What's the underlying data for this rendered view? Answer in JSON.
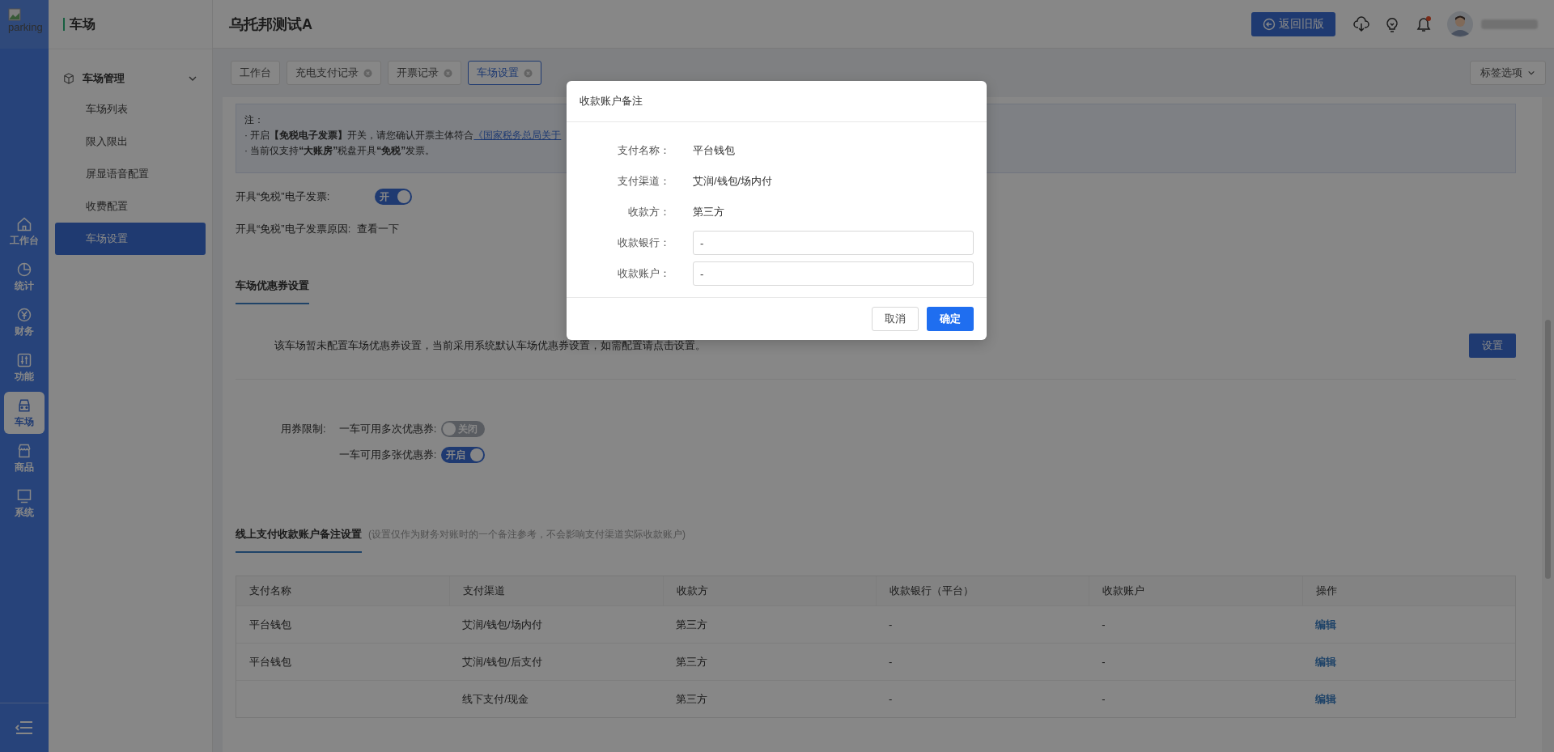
{
  "logo": {
    "alt_text": "parking"
  },
  "rail": [
    {
      "label": "工作台",
      "selected": false
    },
    {
      "label": "统计",
      "selected": false
    },
    {
      "label": "财务",
      "selected": false
    },
    {
      "label": "功能",
      "selected": false
    },
    {
      "label": "车场",
      "selected": true
    },
    {
      "label": "商品",
      "selected": false
    },
    {
      "label": "系统",
      "selected": false
    }
  ],
  "sidebar": {
    "title": "车场",
    "group": {
      "label": "车场管理",
      "expanded": true,
      "items": [
        {
          "label": "车场列表",
          "selected": false
        },
        {
          "label": "限入限出",
          "selected": false
        },
        {
          "label": "屏显语音配置",
          "selected": false
        },
        {
          "label": "收费配置",
          "selected": false
        },
        {
          "label": "车场设置",
          "selected": true
        }
      ]
    }
  },
  "header": {
    "title": "乌托邦测试A",
    "back_button": "返回旧版",
    "notification_dot": true
  },
  "tabs": [
    {
      "label": "工作台",
      "selected": false,
      "closable": false
    },
    {
      "label": "充电支付记录",
      "selected": false,
      "closable": true
    },
    {
      "label": "开票记录",
      "selected": false,
      "closable": true
    },
    {
      "label": "车场设置",
      "selected": true,
      "closable": true
    }
  ],
  "tab_options": "标签选项",
  "note": {
    "heading": "注：",
    "line_1": "· 开启**【免税电子发票】**开关，请您确认开票主体符合",
    "line_1_link": "《国家税务总局关于",
    "line_2": "· 当前仅支持**“大账房”**税盘开具**“免税”**发票。"
  },
  "invoice": {
    "toggle_label": "开具“免税”电子发票:",
    "toggle": {
      "on": true,
      "text": "开"
    },
    "reason_label": "开具“免税”电子发票原因:",
    "reason_value": "查看一下"
  },
  "coupon_section": {
    "title": "车场优惠券设置",
    "message": "该车场暂未配置车场优惠券设置，当前采用系统默认车场优惠券设置，如需配置请点击设置。",
    "button": "设置",
    "limit_label": "用券限制:",
    "limits": [
      {
        "label": "一车可用多次优惠券:",
        "on": false,
        "text": "关闭"
      },
      {
        "label": "一车可用多张优惠券:",
        "on": true,
        "text": "开启"
      }
    ]
  },
  "account_section": {
    "title": "线上支付收款账户备注设置",
    "hint": "(设置仅作为财务对账时的一个备注参考，不会影响支付渠道实际收款账户)",
    "table": {
      "columns": [
        "支付名称",
        "支付渠道",
        "收款方",
        "收款银行（平台）",
        "收款账户",
        "操作"
      ],
      "rows": [
        {
          "name": "平台钱包",
          "channel": "艾润/钱包/场内付",
          "payee": "第三方",
          "bank": "-",
          "account": "-",
          "action": "编辑"
        },
        {
          "name": "平台钱包",
          "channel": "艾润/钱包/后支付",
          "payee": "第三方",
          "bank": "-",
          "account": "-",
          "action": "编辑"
        },
        {
          "name": "",
          "channel": "线下支付/现金",
          "payee": "第三方",
          "bank": "-",
          "account": "-",
          "action": "编辑"
        }
      ]
    }
  },
  "dialog": {
    "title": "收款账户备注",
    "fields": [
      {
        "kind": "text",
        "label": "支付名称：",
        "value": "平台钱包"
      },
      {
        "kind": "text",
        "label": "支付渠道：",
        "value": "艾润/钱包/场内付"
      },
      {
        "kind": "text",
        "label": "收款方：",
        "value": "第三方"
      },
      {
        "kind": "input",
        "label": "收款银行：",
        "value": "-"
      },
      {
        "kind": "input",
        "label": "收款账户：",
        "value": "-"
      }
    ],
    "cancel": "取消",
    "confirm": "确定"
  }
}
